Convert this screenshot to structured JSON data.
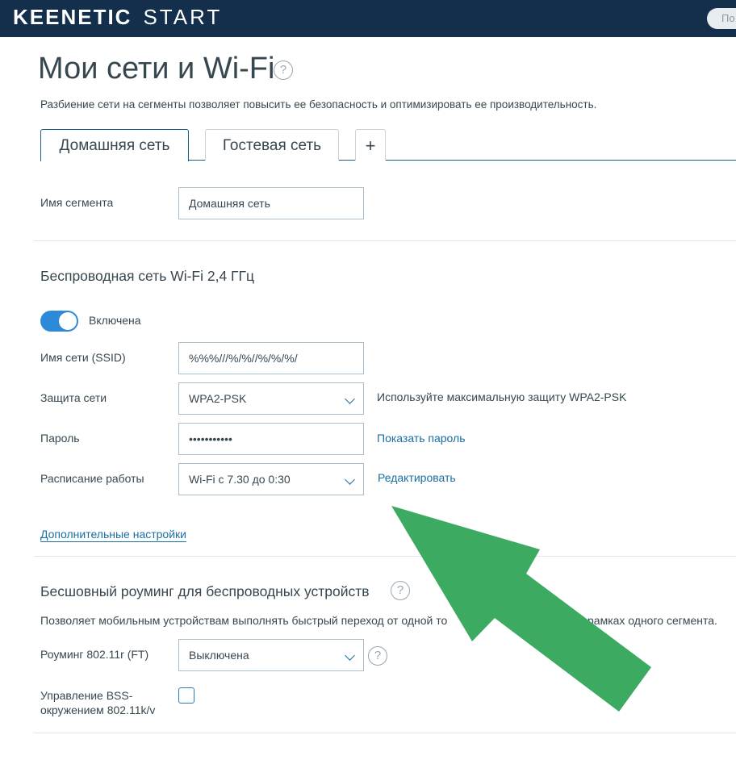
{
  "header": {
    "brand": "KEENETIC",
    "product": "START",
    "top_button": "По"
  },
  "page": {
    "title": "Мои сети и Wi-Fi",
    "help_glyph": "?",
    "subtitle": "Разбиение сети на сегменты позволяет повысить ее безопасность и оптимизировать ее производительность."
  },
  "tabs": [
    {
      "label": "Домашняя сеть",
      "active": true
    },
    {
      "label": "Гостевая сеть",
      "active": false
    },
    {
      "label": "+",
      "active": false
    }
  ],
  "segment": {
    "name_label": "Имя сегмента",
    "name_value": "Домашняя сеть"
  },
  "wifi": {
    "section_title": "Беспроводная сеть Wi-Fi 2,4 ГГц",
    "toggle_label": "Включена",
    "toggle_on": true,
    "ssid_label": "Имя сети (SSID)",
    "ssid_value": "%%%///%/%//%/%/%/",
    "security_label": "Защита сети",
    "security_value": "WPA2-PSK",
    "security_hint": "Используйте максимальную защиту WPA2-PSK",
    "password_label": "Пароль",
    "password_value": "•••••••••••",
    "show_password": "Показать пароль",
    "schedule_label": "Расписание работы",
    "schedule_value": "Wi-Fi с 7.30 до 0:30",
    "edit_link": "Редактировать",
    "advanced_link": "Дополнительные настройки"
  },
  "roaming": {
    "section_title": "Бесшовный роуминг для беспроводных устройств",
    "description": "Позволяет мобильным устройствам выполнять быстрый переход от одной то",
    "description_end": "рамках одного сегмента.",
    "ft_label": "Роуминг 802.11r (FT)",
    "ft_value": "Выключена",
    "bss_label_line1": "Управление BSS-",
    "bss_label_line2": "окружением 802.11k/v",
    "bss_checked": false
  },
  "colors": {
    "topbar": "#132f4c",
    "accent": "#1a6ea2",
    "toggle": "#2d8ad8",
    "arrow": "#3daa62"
  }
}
